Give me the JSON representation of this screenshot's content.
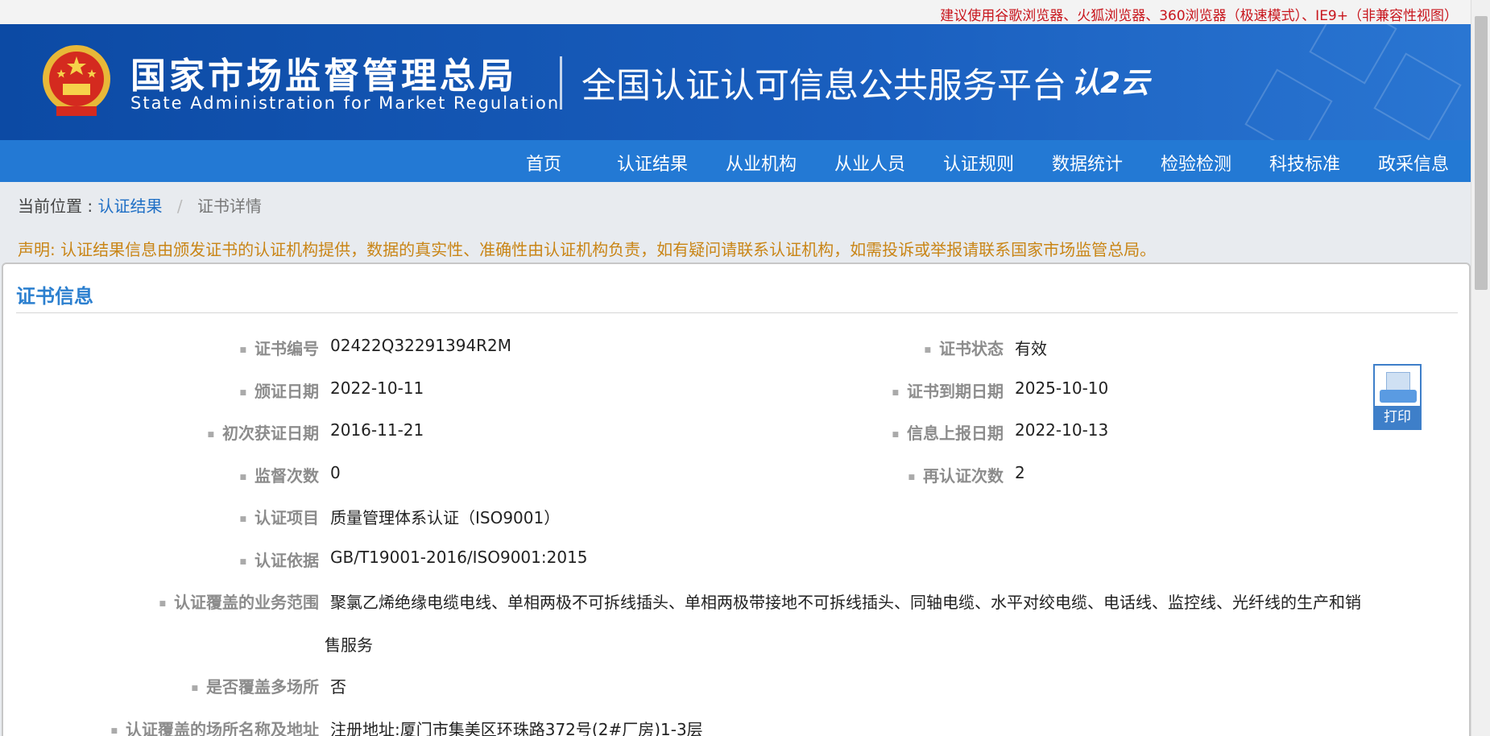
{
  "notice": "建议使用谷歌浏览器、火狐浏览器、360浏览器（极速模式）、IE9+（非兼容性视图）",
  "header": {
    "org_cn": "国家市场监督管理总局",
    "org_en": "State Administration  for  Market Regulation",
    "platform": "全国认证认可信息公共服务平台",
    "logo_text": "认2云",
    "emblem_icon": "national-emblem-icon"
  },
  "nav": [
    "首页",
    "认证结果",
    "从业机构",
    "从业人员",
    "认证规则",
    "数据统计",
    "检验检测",
    "科技标准",
    "政采信息"
  ],
  "breadcrumb": {
    "prefix": "当前位置 :",
    "link": "认证结果",
    "sep": "/",
    "current": "证书详情"
  },
  "statement": "声明: 认证结果信息由颁发证书的认证机构提供，数据的真实性、准确性由认证机构负责，如有疑问请联系认证机构，如需投诉或举报请联系国家市场监管总局。",
  "card": {
    "title": "证书信息",
    "fields": {
      "cert_no": {
        "label": "证书编号",
        "value": "02422Q32291394R2M"
      },
      "status": {
        "label": "证书状态",
        "value": "有效"
      },
      "issue_date": {
        "label": "颁证日期",
        "value": "2022-10-11"
      },
      "expiry_date": {
        "label": "证书到期日期",
        "value": "2025-10-10"
      },
      "first_date": {
        "label": "初次获证日期",
        "value": "2016-11-21"
      },
      "report_date": {
        "label": "信息上报日期",
        "value": "2022-10-13"
      },
      "supervision": {
        "label": "监督次数",
        "value": "0"
      },
      "recert": {
        "label": "再认证次数",
        "value": "2"
      },
      "project": {
        "label": "认证项目",
        "value": "质量管理体系认证（ISO9001）"
      },
      "basis": {
        "label": "认证依据",
        "value": "GB/T19001-2016/ISO9001:2015"
      },
      "scope": {
        "label": "认证覆盖的业务范围",
        "value_line1": "聚氯乙烯绝缘电缆电线、单相两极不可拆线插头、单相两极带接地不可拆线插头、同轴电缆、水平对绞电缆、电话线、监控线、光纤线的生产和销",
        "value_line2": "售服务"
      },
      "multi_site": {
        "label": "是否覆盖多场所",
        "value": "否"
      },
      "address": {
        "label": "认证覆盖的场所名称及地址",
        "value": "注册地址:厦门市集美区环珠路372号(2#厂房)1-3层"
      }
    }
  },
  "print": {
    "label": "打印",
    "icon": "printer-icon"
  },
  "colors": {
    "brand_blue": "#2379d4",
    "banner": "#0c4aa4",
    "notice_red": "#c8161d",
    "statement_orange": "#c98516",
    "title_blue": "#2b7fcf"
  }
}
